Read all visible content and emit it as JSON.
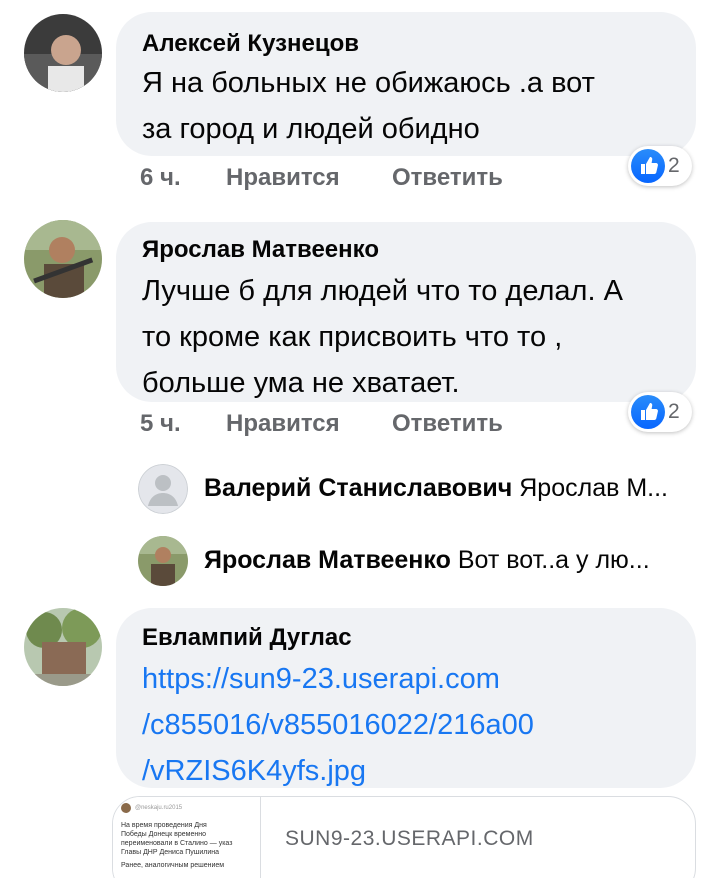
{
  "comments": [
    {
      "author": "Алексей Кузнецов",
      "lines": [
        "Я на больных не обижаюсь .а вот",
        "за город и людей обидно"
      ],
      "time": "6 ч.",
      "like_label": "Нравится",
      "reply_label": "Ответить",
      "reaction_count": "2"
    },
    {
      "author": "Ярослав Матвеенко",
      "lines": [
        "Лучше б для людей что то делал. А",
        "то кроме как присвоить что то ,",
        "больше ума не хватает."
      ],
      "time": "5 ч.",
      "like_label": "Нравится",
      "reply_label": "Ответить",
      "reaction_count": "2"
    },
    {
      "author": "Евлампий Дуглас",
      "link_lines": [
        "https://sun9-23.userapi.com",
        "/c855016/v855016022/216a00",
        "/vRZIS6K4yfs.jpg"
      ]
    }
  ],
  "replies": [
    {
      "author": "Валерий Станиславович",
      "text": "Ярослав М..."
    },
    {
      "author": "Ярослав Матвеенко",
      "text": "Вот вот..а у лю..."
    }
  ],
  "link_preview": {
    "domain": "SUN9-23.USERAPI.COM",
    "thumb_handle": "@neskaju.ru2015",
    "thumb_lines": [
      "На время проведения Дня",
      "Победы Донецк временно",
      "переименовали в Сталино — указ",
      "Главы ДНР Дениса Пушилина",
      "Ранее, аналогичным решением"
    ]
  },
  "colors": {
    "bubble": "#f0f2f5",
    "secondary_text": "#65676b",
    "link": "#1877f2",
    "like_blue": "#0866ff"
  },
  "icons": [
    "like-thumb-icon",
    "default-avatar-icon"
  ]
}
